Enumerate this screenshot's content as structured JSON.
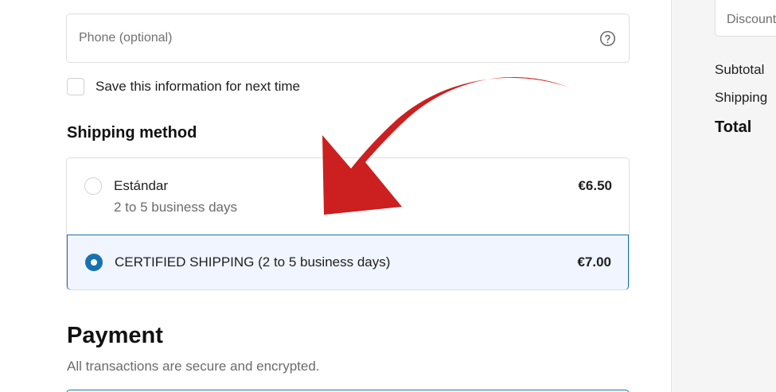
{
  "contact": {
    "phone_placeholder": "Phone (optional)",
    "help_icon": "question-circle-icon",
    "save_info_label": "Save this information for next time"
  },
  "shipping": {
    "heading": "Shipping method",
    "options": [
      {
        "title": "Estándar",
        "subtitle": "2 to 5 business days",
        "price": "€6.50",
        "selected": false
      },
      {
        "title": "CERTIFIED SHIPPING (2 to 5 business days)",
        "price": "€7.00",
        "selected": true
      }
    ]
  },
  "payment": {
    "heading": "Payment",
    "subtitle": "All transactions are secure and encrypted."
  },
  "summary": {
    "discount_placeholder": "Discount code or gift card",
    "subtotal_label": "Subtotal",
    "shipping_label": "Shipping",
    "total_label": "Total"
  },
  "overlay": {
    "arrow_icon": "red-curved-arrow-icon",
    "arrow_color": "#cc1f1f"
  },
  "colors": {
    "accent": "#1773b0",
    "selected_bg": "#f0f5ff"
  }
}
